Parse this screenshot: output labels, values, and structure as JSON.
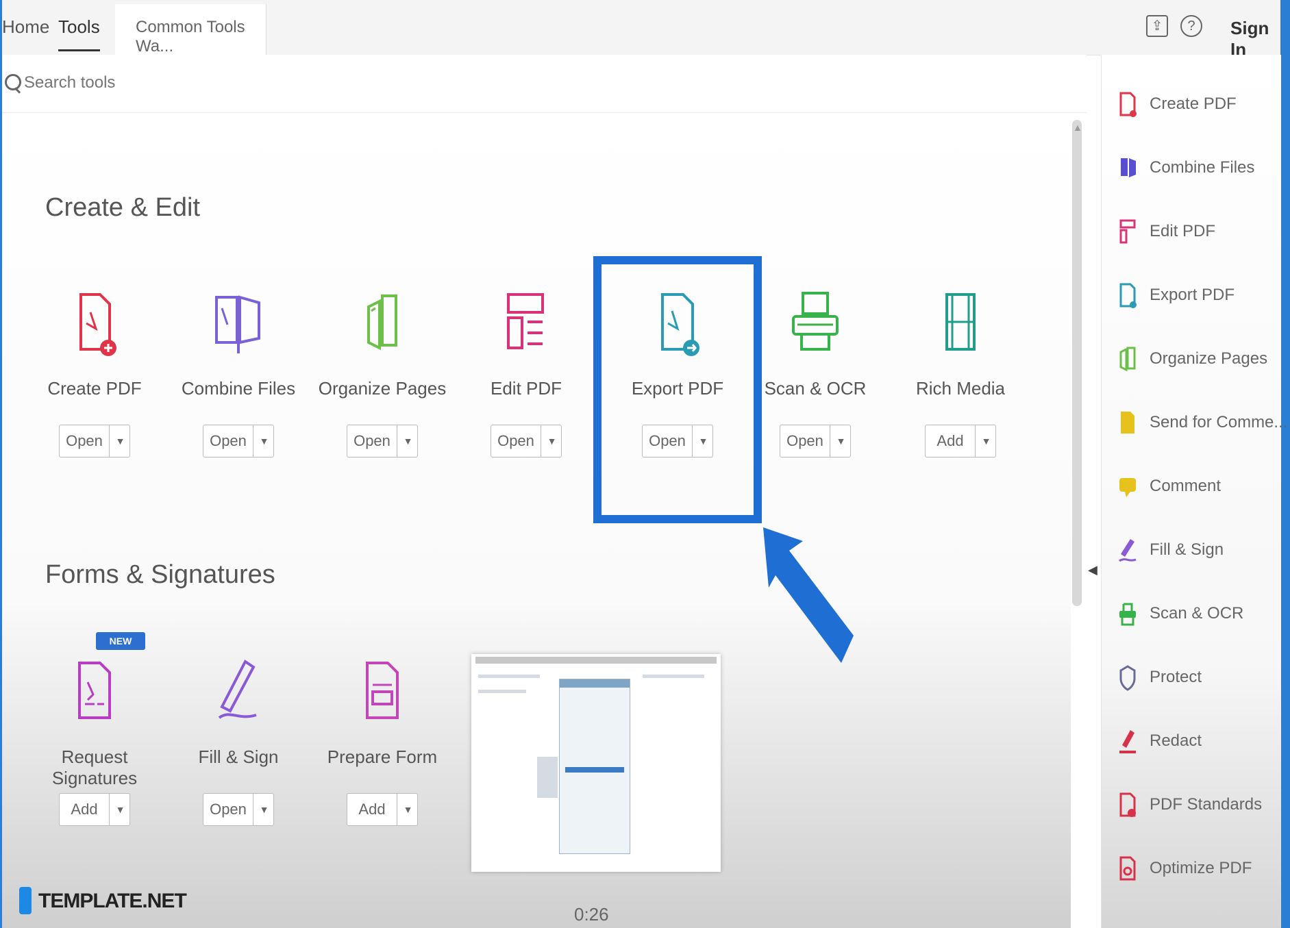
{
  "colors": {
    "highlight": "#1f6ed4",
    "frame": "#2a7fd4",
    "badge": "#2c6fd1"
  },
  "topbar": {
    "tabs": [
      {
        "label": "Home"
      },
      {
        "label": "Tools"
      }
    ],
    "doc_tab": "Common Tools Wa...",
    "signin": "Sign In",
    "icons": [
      "share-icon",
      "help-icon"
    ]
  },
  "search": {
    "placeholder": "Search tools"
  },
  "sections": [
    {
      "title": "Create & Edit",
      "tools": [
        {
          "label": "Create PDF",
          "button": "Open",
          "icon": "create-pdf-icon",
          "color": "#e0344a"
        },
        {
          "label": "Combine Files",
          "button": "Open",
          "icon": "combine-files-icon",
          "color": "#7b61d6"
        },
        {
          "label": "Organize Pages",
          "button": "Open",
          "icon": "organize-pages-icon",
          "color": "#6cc04a"
        },
        {
          "label": "Edit PDF",
          "button": "Open",
          "icon": "edit-pdf-icon",
          "color": "#d83278"
        },
        {
          "label": "Export PDF",
          "button": "Open",
          "icon": "export-pdf-icon",
          "color": "#2a9bb5"
        },
        {
          "label": "Scan & OCR",
          "button": "Open",
          "icon": "scan-ocr-icon",
          "color": "#38b24a"
        },
        {
          "label": "Rich Media",
          "button": "Add",
          "icon": "rich-media-icon",
          "color": "#1f9e8c"
        }
      ]
    },
    {
      "title": "Forms & Signatures",
      "tools": [
        {
          "label": "Request Signatures",
          "button": "Add",
          "icon": "request-signatures-icon",
          "color": "#b83cc4",
          "badge": "NEW"
        },
        {
          "label": "Fill & Sign",
          "button": "Open",
          "icon": "fill-sign-icon",
          "color": "#8a5ad6"
        },
        {
          "label": "Prepare Form",
          "button": "Add",
          "icon": "prepare-form-icon",
          "color": "#c246b8"
        }
      ]
    }
  ],
  "page_counter": "0:26",
  "sidebar": {
    "items": [
      {
        "label": "Create PDF",
        "icon": "create-pdf-icon",
        "color": "#e0344a"
      },
      {
        "label": "Combine Files",
        "icon": "combine-files-icon",
        "color": "#5a4fd0"
      },
      {
        "label": "Edit PDF",
        "icon": "edit-pdf-icon",
        "color": "#d83278"
      },
      {
        "label": "Export PDF",
        "icon": "export-pdf-icon",
        "color": "#2a9bb5"
      },
      {
        "label": "Organize Pages",
        "icon": "organize-pages-icon",
        "color": "#6cc04a"
      },
      {
        "label": "Send for Comme...",
        "icon": "send-for-comment-icon",
        "color": "#e8c21c"
      },
      {
        "label": "Comment",
        "icon": "comment-icon",
        "color": "#e8c21c"
      },
      {
        "label": "Fill & Sign",
        "icon": "fill-sign-icon",
        "color": "#8a5ad6"
      },
      {
        "label": "Scan & OCR",
        "icon": "scan-ocr-icon",
        "color": "#38b24a"
      },
      {
        "label": "Protect",
        "icon": "protect-icon",
        "color": "#6a6a9a"
      },
      {
        "label": "Redact",
        "icon": "redact-icon",
        "color": "#d8324a"
      },
      {
        "label": "PDF Standards",
        "icon": "pdf-standards-icon",
        "color": "#d8324a"
      },
      {
        "label": "Optimize PDF",
        "icon": "optimize-pdf-icon",
        "color": "#d8324a"
      }
    ]
  },
  "watermark": {
    "text": "TEMPLATE.NET"
  }
}
